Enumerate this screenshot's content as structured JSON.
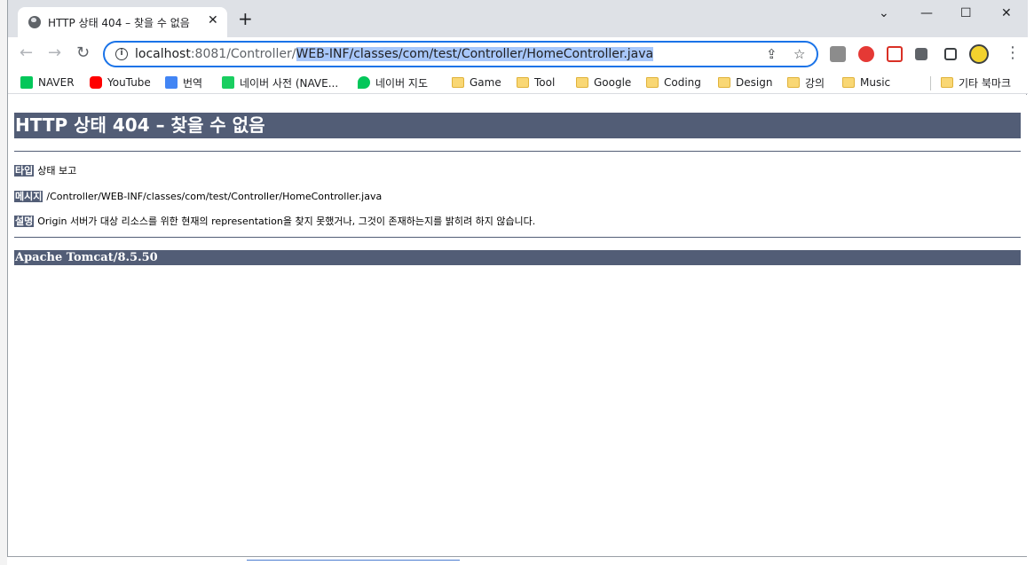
{
  "tab": {
    "title": "HTTP 상태 404 – 찾을 수 없음",
    "close": "✕",
    "new_tab": "+"
  },
  "window_controls": {
    "minimize": "⌄",
    "min": "—",
    "max": "☐",
    "close": "✕"
  },
  "nav": {
    "back": "←",
    "forward": "→",
    "reload": "↻"
  },
  "address": {
    "host": "localhost",
    "port_path": ":8081/Controller/",
    "selected": "WEB-INF/classes/com/test/Controller/HomeController.java"
  },
  "omnibox_icons": {
    "share": "⇪",
    "star": "☆"
  },
  "bookmarks": [
    {
      "label": "NAVER",
      "icon": "naver-icon"
    },
    {
      "label": "YouTube",
      "icon": "youtube-icon"
    },
    {
      "label": "번역",
      "icon": "translate-icon"
    },
    {
      "label": "네이버 사전 (NAVE...",
      "icon": "naver-dict-icon"
    },
    {
      "label": "네이버 지도",
      "icon": "naver-map-icon"
    },
    {
      "label": "Game",
      "icon": "folder-icon"
    },
    {
      "label": "Tool",
      "icon": "folder-icon"
    },
    {
      "label": "Google",
      "icon": "folder-icon"
    },
    {
      "label": "Coding",
      "icon": "folder-icon"
    },
    {
      "label": "Design",
      "icon": "folder-icon"
    },
    {
      "label": "강의",
      "icon": "folder-icon"
    },
    {
      "label": "Music",
      "icon": "folder-icon"
    },
    {
      "label": "기타 북마크",
      "icon": "folder-icon"
    }
  ],
  "page": {
    "heading": "HTTP 상태 404 – 찾을 수 없음",
    "type_label": "타입",
    "type_value": "상태 보고",
    "message_label": "메시지",
    "message_value": "/Controller/WEB-INF/classes/com/test/Controller/HomeController.java",
    "desc_label": "설명",
    "desc_value": "Origin 서버가 대상 리소스를 위한 현재의 representation을 찾지 못했거나, 그것이 존재하는지를 밝히려 하지 않습니다.",
    "footer": "Apache Tomcat/8.5.50"
  },
  "colors": {
    "tomcat_bar": "#525d76",
    "accent": "#1a73e8",
    "selection": "#a8c7fa"
  }
}
